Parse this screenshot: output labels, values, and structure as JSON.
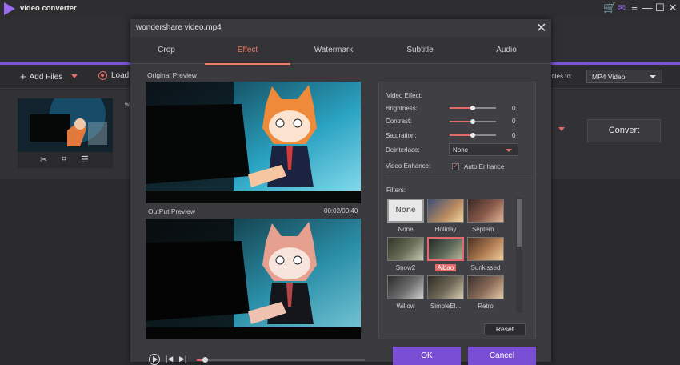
{
  "app": {
    "title": "video converter"
  },
  "window_controls": {
    "cart": "🛒",
    "menu": "≡",
    "minimize": "—",
    "maximize": "☐",
    "close": "✕"
  },
  "toolbar": {
    "add_files": "Add Files",
    "load": "Load",
    "convert_all_label": "ll files to:",
    "format_value": "MP4 Video"
  },
  "file": {
    "convert_label": "Convert",
    "meta_partial": "w"
  },
  "dialog": {
    "title": "wondershare video.mp4",
    "close": "✕",
    "tabs": [
      {
        "label": "Crop"
      },
      {
        "label": "Effect",
        "active": true
      },
      {
        "label": "Watermark"
      },
      {
        "label": "Subtitle"
      },
      {
        "label": "Audio"
      }
    ],
    "original_preview_label": "Original Preview",
    "output_preview_label": "OutPut Preview",
    "output_time": "00:02/00:40",
    "seek_progress": 0.05,
    "effect": {
      "heading": "Video Effect:",
      "brightness": {
        "label": "Brightness:",
        "value": "0",
        "level": 0.5
      },
      "contrast": {
        "label": "Contrast:",
        "value": "0",
        "level": 0.5
      },
      "saturation": {
        "label": "Saturation:",
        "value": "0",
        "level": 0.5
      },
      "deinterlace": {
        "label": "Deinterlace:",
        "value": "None"
      },
      "enhance": {
        "label": "Video Enhance:",
        "checkbox_label": "Auto Enhance",
        "checked": true
      }
    },
    "filters": {
      "heading": "Filters:",
      "items": [
        {
          "label": "None",
          "thumb_text": "None"
        },
        {
          "label": "Holiday"
        },
        {
          "label": "Septem..."
        },
        {
          "label": "Snow2"
        },
        {
          "label": "Aibao",
          "selected": true
        },
        {
          "label": "Sunkissed"
        },
        {
          "label": "Willow"
        },
        {
          "label": "SimpleEl..."
        },
        {
          "label": "Retro"
        }
      ]
    },
    "reset_label": "Reset",
    "ok_label": "OK",
    "cancel_label": "Cancel"
  },
  "colors": {
    "accent": "#e97c62",
    "brand": "#7a4fd6",
    "selection": "#e26a6a"
  }
}
